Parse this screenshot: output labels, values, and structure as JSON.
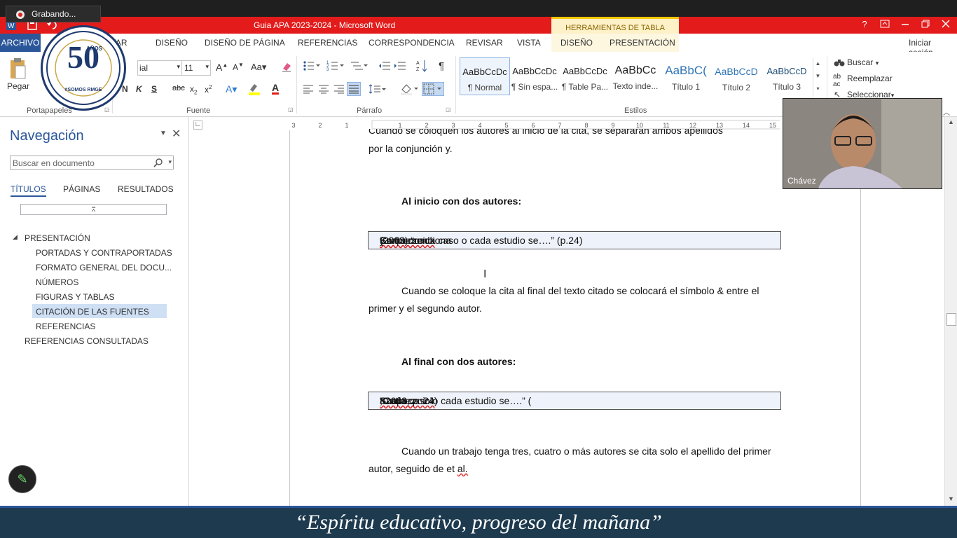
{
  "recording": {
    "label": "Grabando..."
  },
  "window": {
    "title": "Guia APA 2023-2024 -  Microsoft Word",
    "context_group": "HERRAMIENTAS DE TABLA",
    "help": "?",
    "signin": "Iniciar sesión"
  },
  "tabs": {
    "archivo": "ARCHIVO",
    "insertar_partial": "RTAR",
    "diseno": "DISEÑO",
    "diseno_pagina": "DISEÑO DE PÁGINA",
    "referencias": "REFERENCIAS",
    "correspondencia": "CORRESPONDENCIA",
    "revisar": "REVISAR",
    "vista": "VISTA",
    "ctx_diseno": "DISEÑO",
    "ctx_presentacion": "PRESENTACIÓN"
  },
  "ribbon": {
    "pegar": "Pegar",
    "font_name": "ial",
    "font_size": "11",
    "groups": {
      "portapapeles": "Portapapeles",
      "fuente": "Fuente",
      "parrafo": "Párrafo",
      "estilos": "Estilos"
    },
    "styles": [
      {
        "preview": "AaBbCcDc",
        "name": "¶ Normal"
      },
      {
        "preview": "AaBbCcDc",
        "name": "¶ Sin espa..."
      },
      {
        "preview": "AaBbCcDc",
        "name": "¶ Table Pa..."
      },
      {
        "preview": "AaBbCc",
        "name": "Texto inde..."
      },
      {
        "preview": "AaBbC(",
        "name": "Título 1"
      },
      {
        "preview": "AaBbCcD",
        "name": "Título 2"
      },
      {
        "preview": "AaBbCcD",
        "name": "Título 3"
      }
    ],
    "editing": {
      "buscar": "Buscar",
      "reemplazar": "Reemplazar",
      "seleccionar": "Seleccionar"
    }
  },
  "nav": {
    "title": "Navegación",
    "search_placeholder": "Buscar en documento",
    "tabs": {
      "titulos": "TÍTULOS",
      "paginas": "PÁGINAS",
      "resultados": "RESULTADOS"
    },
    "tree": {
      "presentacion": "PRESENTACIÓN",
      "portadas": "PORTADAS Y CONTRAPORTADAS",
      "formato": "FORMATO GENERAL DEL DOCU...",
      "numeros": "NÚMEROS",
      "figuras": "FIGURAS Y TABLAS",
      "citacion": "CITACIÓN DE LAS FUENTES",
      "referencias": "REFERENCIAS",
      "consultadas": "REFERENCIAS CONSULTADAS"
    }
  },
  "doc": {
    "line_top_partial": "Cuando se coloquen los autores al inicio de la cita, se separarán ambos apellidos",
    "line_conj": "por la conjunción y.",
    "h_inicio": "Al inicio con dos autores:",
    "cite1_pre": "Como menciona ",
    "cite1_a1": "Kurtinez",
    "cite1_mid": " y ",
    "cite1_a2": "Szapocznick",
    "cite1_post": " (2003) “cada caso o cada estudio se….” (p.24)",
    "p_final_1": "Cuando se coloque la cita al final del texto citado se colocará el símbolo & entre el",
    "p_final_2": "primer y el segundo autor.",
    "h_final": "Al final con dos autores:",
    "cite2_pre": "“Cada caso o cada estudio se….” (",
    "cite2_a1": "Kurtinez",
    "cite2_mid": " & ",
    "cite2_a2": "Szapocznick",
    "cite2_post": ", 2003, p. 24)",
    "p_tres_1": "Cuando un trabajo tenga tres, cuatro o más autores se cita solo el apellido del primer",
    "p_tres_2a": "autor, seguido de et ",
    "p_tres_2b": "al.",
    "ruler_ticks": [
      "3",
      "2",
      "1",
      "1",
      "2",
      "3",
      "4",
      "5",
      "6",
      "7",
      "8",
      "9",
      "10",
      "11",
      "12",
      "13",
      "14",
      "15"
    ]
  },
  "video": {
    "name": "Chávez"
  },
  "logo": {
    "big": "50",
    "anos": "AÑOS",
    "tag": "#SOMOS RMGE"
  },
  "banner": {
    "text": "“Espíritu educativo, progreso del mañana”"
  }
}
